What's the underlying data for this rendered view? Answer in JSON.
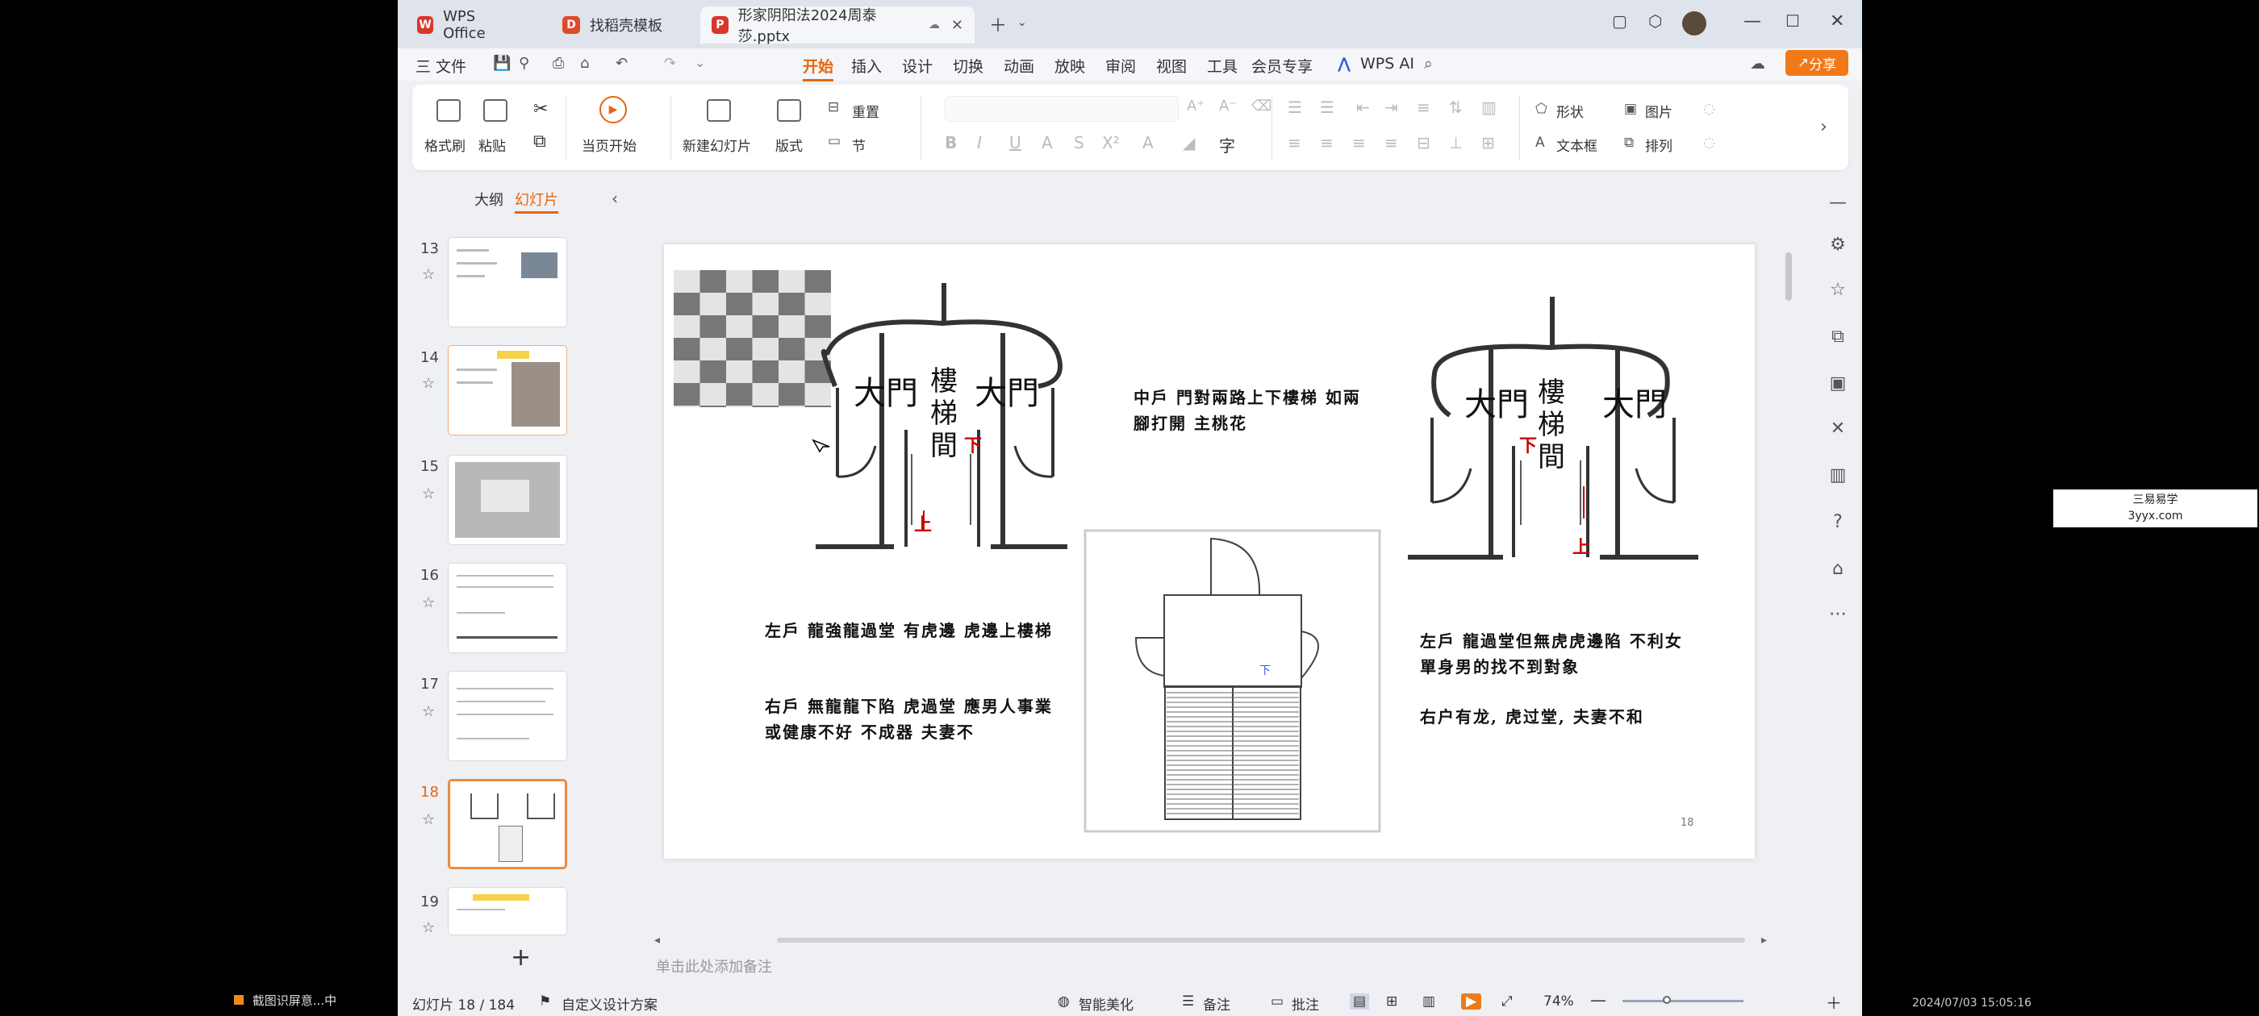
{
  "tabs": [
    {
      "label": "WPS Office"
    },
    {
      "label": "找稻壳模板"
    },
    {
      "label": "形家阴阳法2024周泰莎.pptx"
    }
  ],
  "menu": {
    "file": "三 文件",
    "items": [
      "开始",
      "插入",
      "设计",
      "切换",
      "动画",
      "放映",
      "审阅",
      "视图",
      "工具",
      "会员专享"
    ],
    "ai": "WPS AI",
    "share": "分享"
  },
  "ribbon": {
    "format_painter": "格式刷",
    "paste": "粘贴",
    "from_current": "当页开始",
    "new_slide": "新建幻灯片",
    "layout": "版式",
    "section": "节",
    "reset": "重置",
    "shape": "形状",
    "picture": "图片",
    "textbox": "文本框",
    "arrange": "排列"
  },
  "panel": {
    "outline_tab": "大纲",
    "slides_tab": "幻灯片",
    "slides": [
      {
        "num": "13"
      },
      {
        "num": "14"
      },
      {
        "num": "15"
      },
      {
        "num": "16"
      },
      {
        "num": "17"
      },
      {
        "num": "18"
      },
      {
        "num": "19"
      }
    ]
  },
  "slide": {
    "door": "大門",
    "stair": "樓\n梯\n間",
    "down": "下",
    "up": "上",
    "middle_text": "中戶  門對兩路上下樓梯 如兩腳打開 主桃花",
    "left_text1": "左戶  龍強龍過堂 有虎邊 虎邊上樓梯",
    "left_text2": "右戶  無龍龍下陷 虎過堂 應男人事業或健康不好 不成器 夫妻不",
    "right_text1": "左戶  龍過堂但無虎虎邊陷 不利女 單身男的找不到對象",
    "right_text2": "右户有龙, 虎过堂, 夫妻不和",
    "page": "18"
  },
  "notes_placeholder": "单击此处添加备注",
  "status": {
    "slide_count": "幻灯片 18 / 184",
    "theme": "自定义设计方案",
    "beautify": "智能美化",
    "notes": "备注",
    "comment": "批注",
    "zoom": "74%"
  },
  "taskbar": {
    "label": "截图识屏意...中",
    "time": "2024/07/03 15:05:16"
  },
  "watermark": {
    "line1": "三易易学",
    "line2": "3yyx.com"
  },
  "colors": {
    "accent": "#e8650f",
    "share": "#f07a1a",
    "brand_red": "#d9362b"
  }
}
